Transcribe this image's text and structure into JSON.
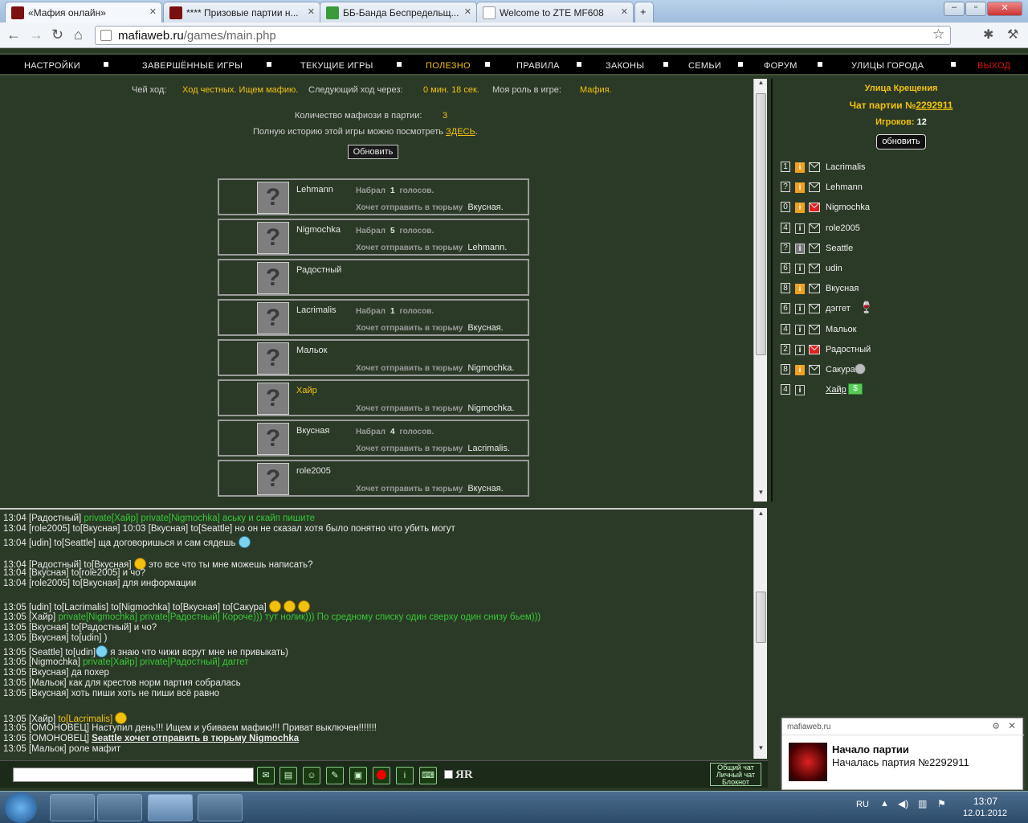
{
  "browser": {
    "tabs": [
      {
        "label": "«Мафия онлайн»"
      },
      {
        "label": "**** Призовые партии н..."
      },
      {
        "label": "ББ-Банда Беспредельщ..."
      },
      {
        "label": "Welcome to ZTE MF608"
      }
    ],
    "new_tab": "+",
    "url_host": "mafiaweb.ru",
    "url_path": "/games/main.php"
  },
  "menu": {
    "items": [
      "НАСТРОЙКИ",
      "ЗАВЕРШЁННЫЕ ИГРЫ",
      "ТЕКУЩИЕ ИГРЫ",
      "ПОЛЕЗНО",
      "ПРАВИЛА",
      "ЗАКОНЫ",
      "СЕМЬИ",
      "ФОРУМ",
      "УЛИЦЫ ГОРОДА",
      "ВЫХОД"
    ],
    "colors": {
      "active": "#f2c10e",
      "exit": "#e01010",
      "normal": "#e8e8e8"
    }
  },
  "game": {
    "turn_label": "Чей ход:",
    "turn_value": "Ход честных. Ищем мафию.",
    "next_label": "Следующий ход через:",
    "next_value": "0 мин. 18 сек.",
    "role_label": "Моя роль в игре:",
    "role_value": "Мафия.",
    "mafia_count_label": "Количество мафиози в партии:",
    "mafia_count_value": "3",
    "history_text": "Полную историю этой игры можно посмотреть",
    "history_link": "ЗДЕСЬ",
    "history_end": ".",
    "refresh_button": "Обновить",
    "votes_word": "Набрал",
    "votes_suffix": "голосов.",
    "wants_text": "Хочет отправить в тюрьму",
    "players": [
      {
        "name": "Lehmann",
        "votes": "1",
        "target": "Вкусная."
      },
      {
        "name": "Nigmochka",
        "votes": "5",
        "target": "Lehmann."
      },
      {
        "name": "Радостный",
        "votes": "",
        "target": ""
      },
      {
        "name": "Lacrimalis",
        "votes": "1",
        "target": "Вкусная."
      },
      {
        "name": "Мальок",
        "votes": "",
        "target": "Nigmochka."
      },
      {
        "name": "Хайр",
        "votes": "",
        "target": "Nigmochka."
      },
      {
        "name": "Вкусная",
        "votes": "4",
        "target": "Lacrimalis."
      },
      {
        "name": "role2005",
        "votes": "",
        "target": "Вкусная."
      }
    ]
  },
  "sidebar": {
    "street": "Улица Крещения",
    "chat_label": "Чат партии №",
    "chat_number": "2292911",
    "players_label": "Игроков:",
    "players_count": "12",
    "refresh_button": "обновить",
    "players": [
      {
        "num": "1",
        "name": "Lacrimalis"
      },
      {
        "num": "?",
        "name": "Lehmann"
      },
      {
        "num": "0",
        "name": "Nigmochka"
      },
      {
        "num": "4",
        "name": "role2005"
      },
      {
        "num": "?",
        "name": "Seattle"
      },
      {
        "num": "6",
        "name": "udin"
      },
      {
        "num": "8",
        "name": "Вкусная"
      },
      {
        "num": "6",
        "name": "дэггет"
      },
      {
        "num": "4",
        "name": "Мальок"
      },
      {
        "num": "2",
        "name": "Радостный"
      },
      {
        "num": "8",
        "name": "Сакура"
      },
      {
        "num": "4",
        "name": "Хайр"
      }
    ]
  },
  "chat": {
    "lines": [
      {
        "t": "13:04 [Радостный] ",
        "g": "private[Хайр] private[Nigmochka] аську и скайп пишите",
        "r": ""
      },
      {
        "t": "13:04 [role2005] to[Вкусная] 10:03 [Вкусная] to[Seattle] но он не сказал хотя было понятно что убить могут",
        "g": "",
        "r": ""
      },
      {
        "t": "13:04 [udin] to[Seattle] ща договоришься и сам сядешь",
        "g": "",
        "r": ""
      },
      {
        "t": "13:04 [Радостный] to[Вкусная]",
        "g": "",
        "r": "это все что ты мне можешь написать?"
      },
      {
        "t": "13:04 [Вкусная] to[role2005] и чо?",
        "g": "",
        "r": ""
      },
      {
        "t": "13:04 [role2005] to[Вкусная] для информации",
        "g": "",
        "r": ""
      },
      {
        "t": "13:05 [udin] to[Lacrimalis] to[Nigmochka] to[Вкусная] to[Сакура]",
        "g": "",
        "r": ""
      },
      {
        "t": "13:05 [Хайр] ",
        "g": "private[Nigmochka] private[Радостный] Короче))) тут нолик))) По средному списку один сверху один снизу бьем)))",
        "r": ""
      },
      {
        "t": "13:05 [Вкусная] to[Радостный] и чо?",
        "g": "",
        "r": ""
      },
      {
        "t": "13:05 [Вкусная] to[udin] )",
        "g": "",
        "r": ""
      },
      {
        "t": "13:05 [Seattle] to[udin]",
        "g": "",
        "r": "я знаю что чижи всрут мне не привыкать)"
      },
      {
        "t": "13:05 [Nigmochka] ",
        "g": "private[Хайр] private[Радостный] даггет",
        "r": ""
      },
      {
        "t": "13:05 [Вкусная] да похер",
        "g": "",
        "r": ""
      },
      {
        "t": "13:05 [Мальок] как для крестов норм партия собралась",
        "g": "",
        "r": ""
      },
      {
        "t": "13:05 [Вкусная] хоть пиши хоть не пиши всё равно",
        "g": "",
        "r": ""
      },
      {
        "t": "13:05 [Хайр] ",
        "g": "",
        "r": "",
        "y": "to[Lacrimalis]"
      },
      {
        "t": "13:05 [ОМОНОВЕЦ] Наступил день!!! Ищем и убиваем мафию!!! Приват выключен!!!!!!!",
        "g": "",
        "r": ""
      },
      {
        "t": "13:05 [ОМОНОВЕЦ] ",
        "g": "",
        "r": "",
        "b": "Seattle хочет отправить в тюрьму Nigmochka"
      },
      {
        "t": "13:05 [Мальок] роле мафит",
        "g": "",
        "r": ""
      }
    ]
  },
  "chatbar": {
    "links": [
      "Общий чат",
      "Личный чат",
      "Блокнот"
    ],
    "yr": "ЯR"
  },
  "notification": {
    "source": "mafiaweb.ru",
    "title": "Начало партии",
    "body": "Началась партия №2292911"
  },
  "taskbar": {
    "lang": "RU",
    "time": "13:07",
    "date": "12.01.2012"
  }
}
